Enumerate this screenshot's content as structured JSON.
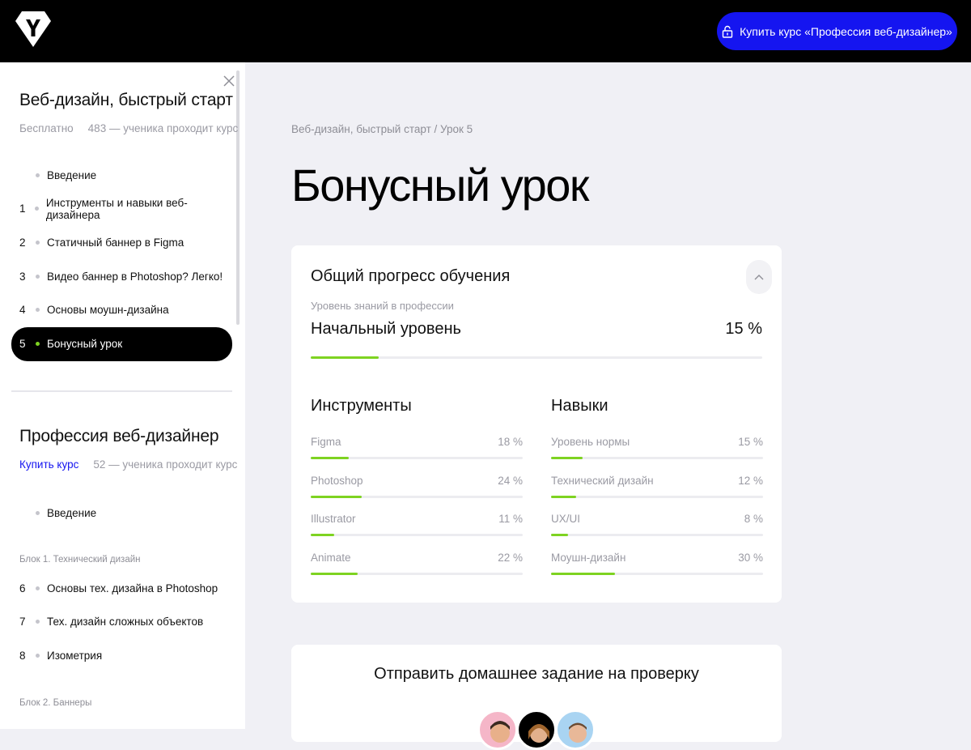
{
  "header": {
    "buy_label": "Купить курс «Профессия веб-дизайнер»"
  },
  "sidebar": {
    "course1": {
      "title": "Веб-дизайн, быстрый старт",
      "price": "Бесплатно",
      "students": "483 — ученика проходит курс",
      "lessons": [
        {
          "num": "",
          "label": "Введение"
        },
        {
          "num": "1",
          "label": "Инструменты и навыки веб-дизайнера"
        },
        {
          "num": "2",
          "label": "Статичный баннер в Figma"
        },
        {
          "num": "3",
          "label": "Видео баннер в Photoshop? Легко!"
        },
        {
          "num": "4",
          "label": "Основы моушн-дизайна"
        },
        {
          "num": "5",
          "label": "Бонусный урок"
        }
      ]
    },
    "course2": {
      "title": "Профессия веб-дизайнер",
      "buy_link": "Купить курс",
      "students": "52 — ученика проходит курс",
      "intro": "Введение",
      "block1": "Блок 1. Технический дизайн",
      "lessons_block1": [
        {
          "num": "6",
          "label": "Основы тех. дизайна в Photoshop"
        },
        {
          "num": "7",
          "label": "Тех. дизайн сложных объектов"
        },
        {
          "num": "8",
          "label": "Изометрия"
        }
      ],
      "block2": "Блок 2. Баннеры"
    }
  },
  "main": {
    "breadcrumb": "Веб-дизайн, быстрый старт / Урок 5",
    "title": "Бонусный урок",
    "progress_card": {
      "title": "Общий прогресс обучения",
      "subtitle": "Уровень знаний в профессии",
      "level": "Начальный уровень",
      "level_pct": "15 %",
      "level_value": 15,
      "tools_title": "Инструменты",
      "skills_title": "Навыки",
      "tools": [
        {
          "label": "Figma",
          "pct": "18 %",
          "value": 18
        },
        {
          "label": "Photoshop",
          "pct": "24 %",
          "value": 24
        },
        {
          "label": "Illustrator",
          "pct": "11 %",
          "value": 11
        },
        {
          "label": "Animate",
          "pct": "22 %",
          "value": 22
        }
      ],
      "skills": [
        {
          "label": "Уровень нормы",
          "pct": "15 %",
          "value": 15
        },
        {
          "label": "Технический дизайн",
          "pct": "12 %",
          "value": 12
        },
        {
          "label": "UX/UI",
          "pct": "8 %",
          "value": 8
        },
        {
          "label": "Моушн-дизайн",
          "pct": "30 %",
          "value": 30
        }
      ]
    },
    "homework_card": {
      "title": "Отправить домашнее задание на проверку"
    }
  },
  "colors": {
    "accent": "#1515f0",
    "progress": "#7ed321",
    "header_bg": "#000000"
  }
}
